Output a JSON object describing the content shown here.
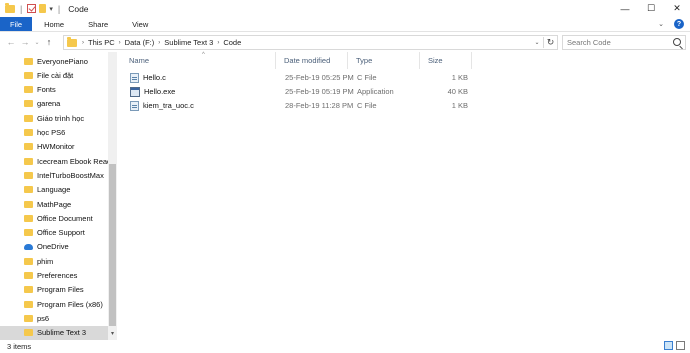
{
  "window": {
    "title": "Code",
    "controls": [
      "—",
      "☐",
      "✕"
    ]
  },
  "ribbon": {
    "tabs": [
      "File",
      "Home",
      "Share",
      "View"
    ]
  },
  "address": {
    "crumbs": [
      "This PC",
      "Data (F:)",
      "Sublime Text 3",
      "Code"
    ],
    "search_placeholder": "Search Code"
  },
  "nav_pane": {
    "items": [
      {
        "label": "EveryonePiano",
        "icon": "folder-icon"
      },
      {
        "label": "File cài đặt",
        "icon": "folder-icon"
      },
      {
        "label": "Fonts",
        "icon": "folder-icon"
      },
      {
        "label": "garena",
        "icon": "folder-icon"
      },
      {
        "label": "Giáo trình học",
        "icon": "folder-icon"
      },
      {
        "label": "học PS6",
        "icon": "folder-icon"
      },
      {
        "label": "HWMonitor",
        "icon": "folder-icon"
      },
      {
        "label": "Icecream Ebook Reade",
        "icon": "folder-icon"
      },
      {
        "label": "IntelTurboBoostMax",
        "icon": "folder-icon"
      },
      {
        "label": "Language",
        "icon": "folder-icon"
      },
      {
        "label": "MathPage",
        "icon": "folder-icon"
      },
      {
        "label": "Office Document",
        "icon": "folder-icon"
      },
      {
        "label": "Office Support",
        "icon": "folder-icon"
      },
      {
        "label": "OneDrive",
        "icon": "onedrive-icon"
      },
      {
        "label": "phim",
        "icon": "folder-icon"
      },
      {
        "label": "Preferences",
        "icon": "folder-icon"
      },
      {
        "label": "Program Files",
        "icon": "folder-icon"
      },
      {
        "label": "Program Files (x86)",
        "icon": "folder-icon"
      },
      {
        "label": "ps6",
        "icon": "folder-icon"
      },
      {
        "label": "Sublime Text 3",
        "icon": "folder-icon",
        "selected": true
      }
    ]
  },
  "file_list": {
    "columns": [
      "Name",
      "Date modified",
      "Type",
      "Size"
    ],
    "rows": [
      {
        "name": "Hello.c",
        "date": "25-Feb-19 05:25 PM",
        "type": "C File",
        "size": "1 KB",
        "icon": "c-file-icon"
      },
      {
        "name": "Hello.exe",
        "date": "25-Feb-19 05:19 PM",
        "type": "Application",
        "size": "40 KB",
        "icon": "exe-file-icon"
      },
      {
        "name": "kiem_tra_uoc.c",
        "date": "28-Feb-19 11:28 PM",
        "type": "C File",
        "size": "1 KB",
        "icon": "c-file-icon"
      }
    ]
  },
  "status": {
    "item_count": "3 items"
  },
  "colors": {
    "file_tab": "#1a64c8",
    "folder": "#f5c84c",
    "selected_bg": "#d9d9d9",
    "column_header_text": "#4c607a"
  }
}
